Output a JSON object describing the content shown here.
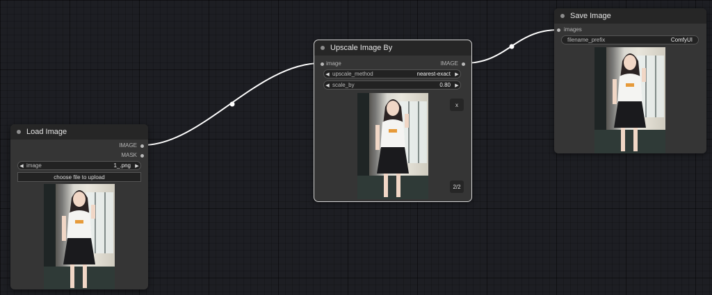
{
  "load_image": {
    "title": "Load Image",
    "outputs": [
      "IMAGE",
      "MASK"
    ],
    "image_widget": {
      "label": "image",
      "value": "1_.png"
    },
    "upload_label": "choose file to upload"
  },
  "upscale": {
    "title": "Upscale Image By",
    "input_label": "image",
    "output_label": "IMAGE",
    "upscale_method": {
      "label": "upscale_method",
      "value": "nearest-exact"
    },
    "scale_by": {
      "label": "scale_by",
      "value": "0.80"
    },
    "close_label": "x",
    "page_label": "2/2"
  },
  "save_image": {
    "title": "Save Image",
    "input_label": "images",
    "filename_prefix": {
      "label": "filename_prefix",
      "value": "ComfyUI"
    }
  },
  "icons": {
    "left_arrow": "◀",
    "right_arrow": "▶"
  },
  "colors": {
    "canvas": "#1d1e23",
    "node": "#353535",
    "title_bar": "#262626",
    "wire": "#ffffff"
  }
}
